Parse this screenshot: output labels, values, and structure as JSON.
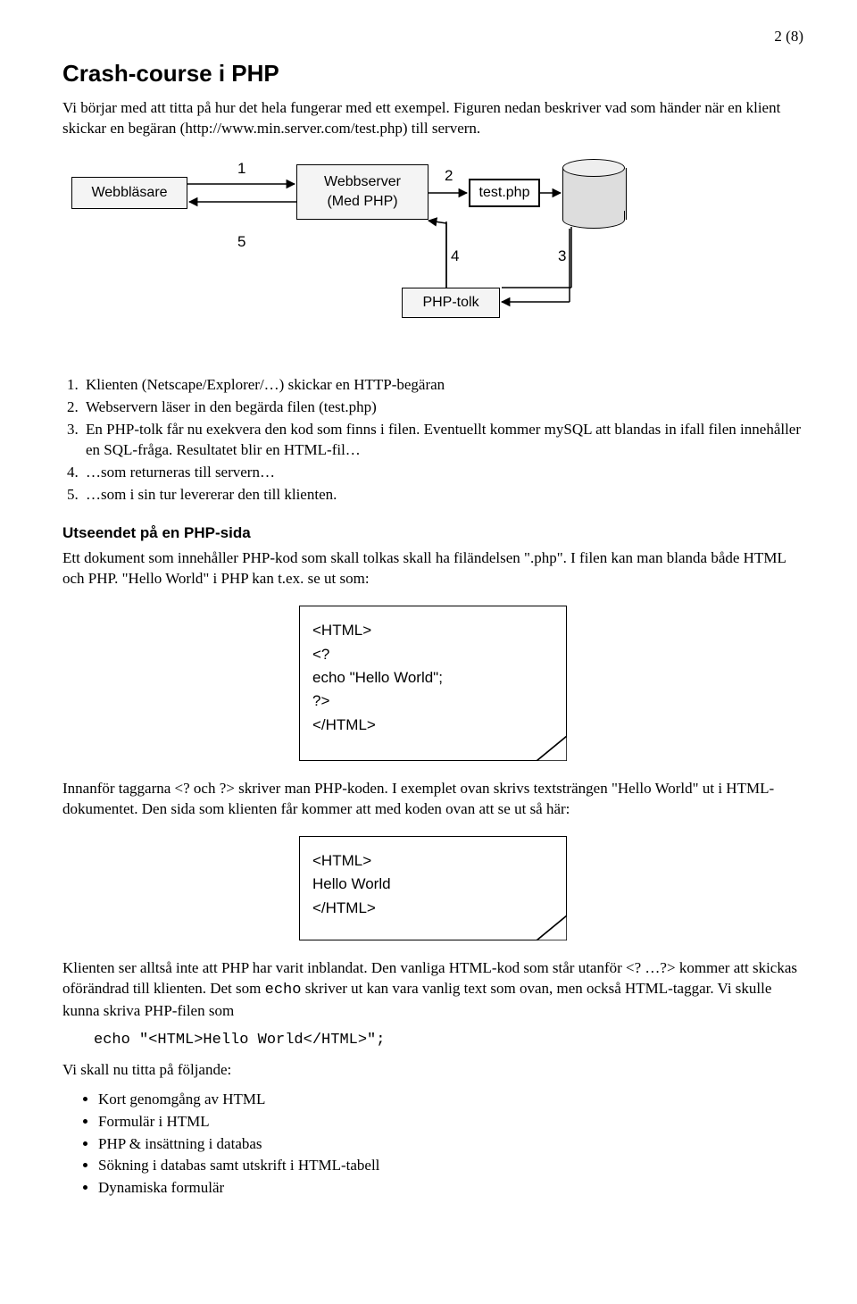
{
  "page_number": "2 (8)",
  "title": "Crash-course i PHP",
  "intro": "Vi börjar med att titta på hur det hela fungerar med ett exempel. Figuren nedan beskriver vad som händer när en klient skickar en begäran (http://www.min.server.com/test.php) till servern.",
  "diagram": {
    "browser": "Webbläsare",
    "server_line1": "Webbserver",
    "server_line2": "(Med PHP)",
    "testphp": "test.php",
    "phptolk": "PHP-tolk",
    "n1": "1",
    "n2": "2",
    "n3": "3",
    "n4": "4",
    "n5": "5"
  },
  "steps": [
    "Klienten (Netscape/Explorer/…) skickar en HTTP-begäran",
    "Webservern läser in den begärda filen (test.php)",
    "En PHP-tolk får nu exekvera den kod som finns i filen. Eventuellt kommer mySQL att blandas in ifall filen innehåller en SQL-fråga. Resultatet blir en HTML-fil…",
    "…som returneras till servern…",
    "…som i sin tur levererar den till klienten."
  ],
  "section2_heading": "Utseendet på en PHP-sida",
  "section2_p1": "Ett dokument som innehåller PHP-kod som skall tolkas skall ha filändelsen \".php\". I filen kan man blanda både HTML och PHP. \"Hello World\" i PHP kan t.ex. se ut som:",
  "code1": {
    "l1": "<HTML>",
    "l2": "<?",
    "l3": "  echo \"Hello World\";",
    "l4": "?>",
    "l5": "</HTML>"
  },
  "p_after_code1": "Innanför taggarna <? och ?> skriver man PHP-koden. I exemplet ovan skrivs textsträngen \"Hello World\" ut i HTML-dokumentet. Den sida som klienten får kommer att med koden ovan att se ut så här:",
  "code2": {
    "l1": "<HTML>",
    "l2": "Hello World",
    "l3": "</HTML>"
  },
  "p_after_code2a": "Klienten ser alltså inte att PHP har varit inblandat. Den vanliga HTML-kod som står utanför <? …?> kommer att skickas oförändrad till klienten. Det som ",
  "p_after_code2_mono": "echo",
  "p_after_code2b": " skriver ut kan vara vanlig text som ovan, men också HTML-taggar. Vi skulle kunna skriva PHP-filen som",
  "codeline": "echo \"<HTML>Hello World</HTML>\";",
  "p_following": "Vi skall nu titta på följande:",
  "bullets": [
    "Kort genomgång av HTML",
    "Formulär i HTML",
    "PHP & insättning i databas",
    "Sökning i databas samt utskrift i HTML-tabell",
    "Dynamiska formulär"
  ]
}
